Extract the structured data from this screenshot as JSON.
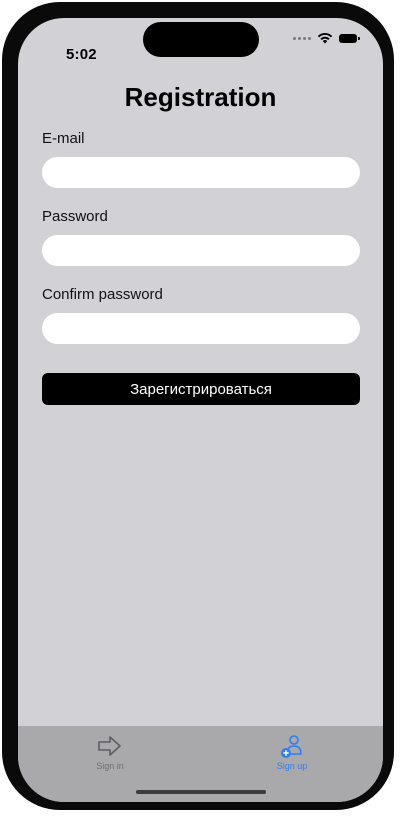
{
  "status_bar": {
    "time": "5:02"
  },
  "page": {
    "title": "Registration"
  },
  "form": {
    "email": {
      "label": "E-mail",
      "value": "",
      "placeholder": ""
    },
    "password": {
      "label": "Password",
      "value": "",
      "placeholder": ""
    },
    "confirm_password": {
      "label": "Confirm password",
      "value": "",
      "placeholder": ""
    },
    "submit_label": "Зарегистрироваться"
  },
  "tab_bar": {
    "items": [
      {
        "label": "Sign in",
        "icon": "arrow-right-icon",
        "selected": false,
        "color": "#6e6e72"
      },
      {
        "label": "Sign up",
        "icon": "person-add-icon",
        "selected": true,
        "color": "#2f7df6"
      }
    ]
  },
  "colors": {
    "background": "#d2d1d6",
    "tab_bar": "#a9a9ab",
    "accent": "#2f7df6",
    "button": "#000000"
  }
}
